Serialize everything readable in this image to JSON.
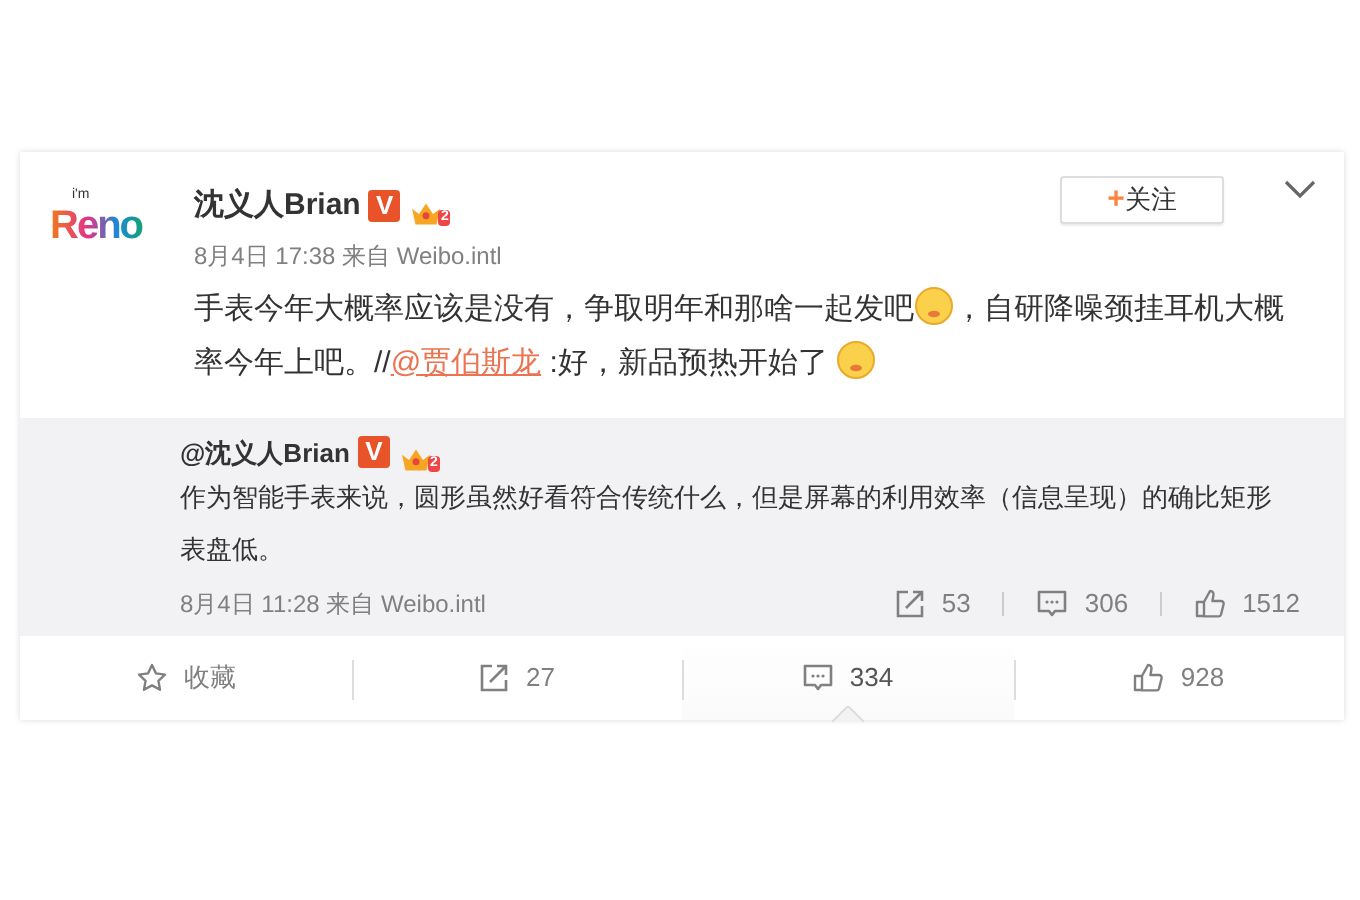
{
  "post": {
    "author": {
      "name": "沈义人Brian",
      "verified": "V",
      "level": "2",
      "logo": "Reno",
      "logo_tag": "i'm"
    },
    "follow_button": {
      "plus": "+",
      "label": "关注"
    },
    "meta": "8月4日 17:38 来自 Weibo.intl",
    "content": [
      {
        "kind": "text",
        "text": "手表今年大概率应该是没有，争取明年和那啥一起发吧"
      },
      {
        "kind": "emoji"
      },
      {
        "kind": "text",
        "text": "，自研降噪颈挂耳机大概率今年上吧。//"
      },
      {
        "kind": "mention",
        "text": "@贾伯斯龙"
      },
      {
        "kind": "text",
        "text": " :好，新品预热开始了 "
      },
      {
        "kind": "emoji"
      }
    ],
    "repost": {
      "author": "@沈义人Brian",
      "verified": "V",
      "level": "2",
      "text": "作为智能手表来说，圆形虽然好看符合传统什么，但是屏幕的利用效率（信息呈现）的确比矩形表盘低。",
      "meta": "8月4日 11:28 来自 Weibo.intl",
      "stats": [
        {
          "kind": "share",
          "count": "53"
        },
        {
          "kind": "comment",
          "count": "306"
        },
        {
          "kind": "like",
          "count": "1512"
        }
      ]
    },
    "actions": [
      {
        "kind": "favorite",
        "label": "收藏",
        "selected": false
      },
      {
        "kind": "share",
        "label": "27",
        "selected": false
      },
      {
        "kind": "comment",
        "label": "334",
        "selected": true
      },
      {
        "kind": "like",
        "label": "928",
        "selected": false
      }
    ]
  }
}
